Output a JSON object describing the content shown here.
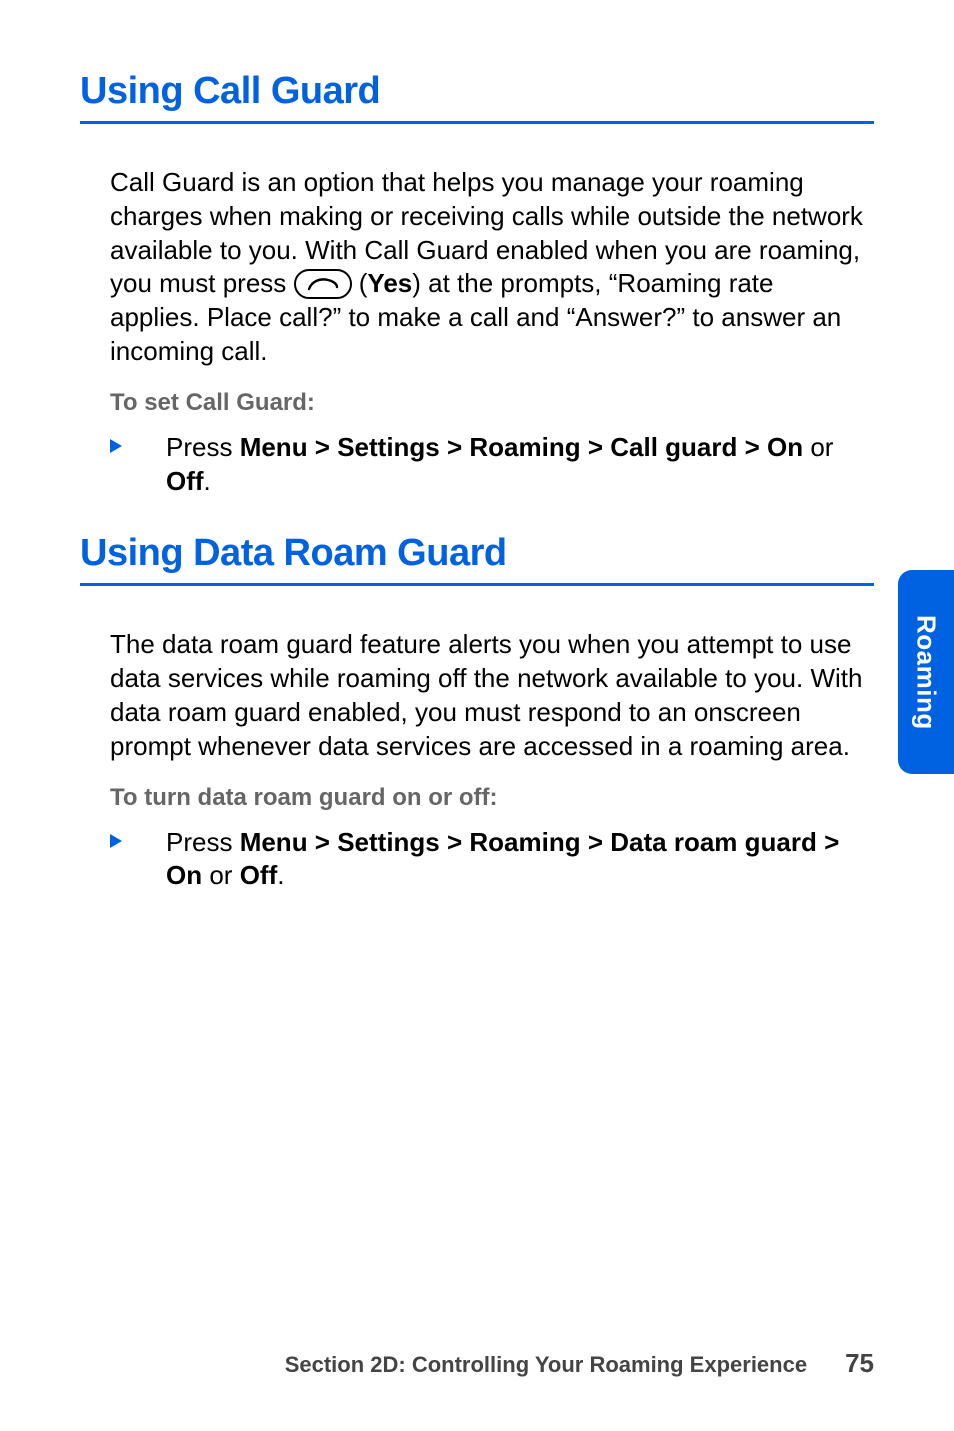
{
  "headings": {
    "call_guard": "Using Call Guard",
    "data_roam_guard": "Using Data Roam Guard"
  },
  "call_guard": {
    "para_pre": "Call Guard is an option that helps you manage your roaming charges when making or receiving calls while outside the network available to you. With Call Guard enabled when you are roaming, you must press ",
    "yes_open": " (",
    "yes_label": "Yes",
    "para_post": ") at the prompts, “Roaming rate applies. Place call?” to make a call and “Answer?” to answer an incoming call.",
    "subheading": "To set Call Guard:",
    "bullet_prefix": "Press ",
    "bullet_bold": "Menu > Settings > Roaming > Call guard > On",
    "bullet_mid": " or ",
    "bullet_off": "Off",
    "bullet_end": "."
  },
  "data_roam_guard": {
    "para": "The data roam guard feature alerts you when you attempt to use data services while roaming off the network available to you. With data roam guard enabled, you must respond to an onscreen prompt whenever data services are accessed in a roaming area.",
    "subheading": "To turn data roam guard on or off:",
    "bullet_prefix": "Press ",
    "bullet_bold": "Menu > Settings > Roaming > Data roam guard > On",
    "bullet_mid": " or ",
    "bullet_off": "Off",
    "bullet_end": "."
  },
  "side_tab": "Roaming",
  "footer": {
    "title": "Section 2D: Controlling Your Roaming Experience",
    "page": "75"
  }
}
